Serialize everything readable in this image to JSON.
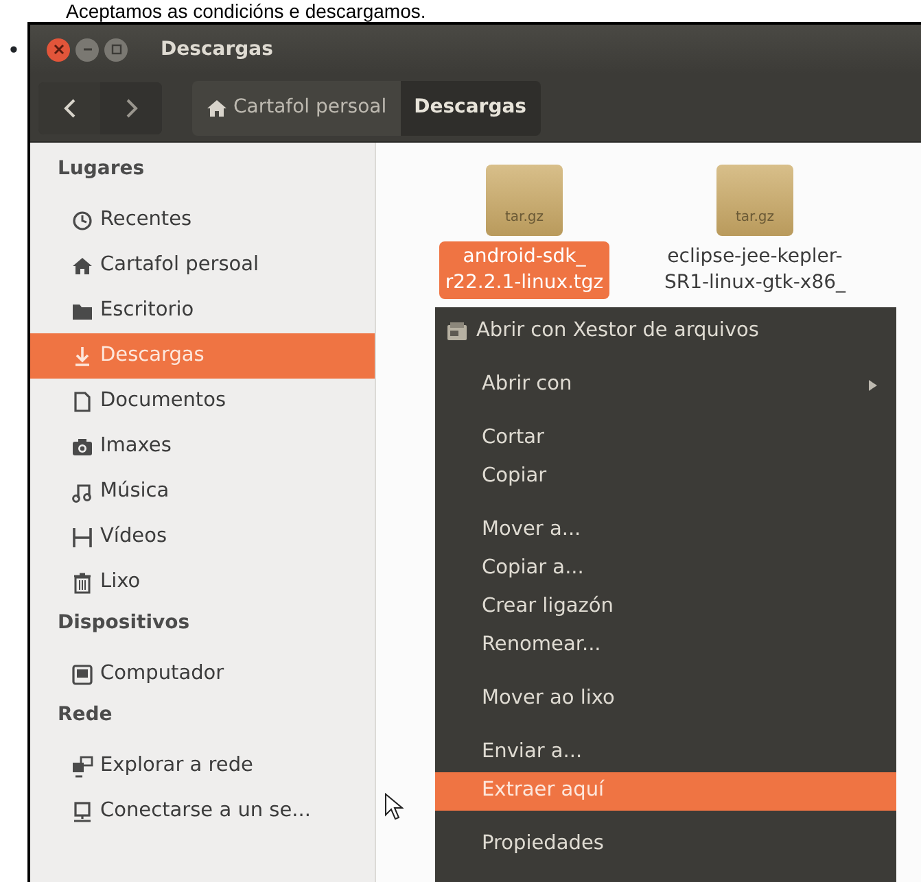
{
  "page_text": "Aceptamos as condicións e descargamos.",
  "bullet": "•",
  "window": {
    "title": "Descargas"
  },
  "breadcrumbs": [
    {
      "label": "Cartafol persoal",
      "kind": "home",
      "selected": false
    },
    {
      "label": "Descargas",
      "kind": "plain",
      "selected": true
    }
  ],
  "sidebar": {
    "sections": [
      {
        "title": "Lugares",
        "items": [
          {
            "label": "Recentes",
            "kind": "clock",
            "selected": false
          },
          {
            "label": "Cartafol persoal",
            "kind": "home",
            "selected": false
          },
          {
            "label": "Escritorio",
            "kind": "folder",
            "selected": false
          },
          {
            "label": "Descargas",
            "kind": "download",
            "selected": true
          },
          {
            "label": "Documentos",
            "kind": "document",
            "selected": false
          },
          {
            "label": "Imaxes",
            "kind": "camera",
            "selected": false
          },
          {
            "label": "Música",
            "kind": "music",
            "selected": false
          },
          {
            "label": "Vídeos",
            "kind": "film",
            "selected": false
          },
          {
            "label": "Lixo",
            "kind": "trash",
            "selected": false
          }
        ]
      },
      {
        "title": "Dispositivos",
        "items": [
          {
            "label": "Computador",
            "kind": "drive",
            "selected": false
          }
        ]
      },
      {
        "title": "Rede",
        "items": [
          {
            "label": "Explorar a rede",
            "kind": "network",
            "selected": false
          },
          {
            "label": "Conectarse a un se...",
            "kind": "server",
            "selected": false
          }
        ]
      }
    ]
  },
  "files": [
    {
      "badge": "tar.gz",
      "lines": [
        "android-sdk_",
        "r22.2.1-linux.tgz"
      ],
      "selected": true
    },
    {
      "badge": "tar.gz",
      "lines": [
        "eclipse-jee-kepler-",
        "SR1-linux-gtk-x86_"
      ],
      "selected": false
    }
  ],
  "context_menu": {
    "items": [
      {
        "label": "Abrir con Xestor de arquivos",
        "kind": "icon",
        "gap_before": false,
        "selected": false
      },
      {
        "label": "Abrir con",
        "kind": "submenu",
        "gap_before": true,
        "selected": false
      },
      {
        "label": "Cortar",
        "kind": "plain",
        "gap_before": true,
        "selected": false
      },
      {
        "label": "Copiar",
        "kind": "plain",
        "gap_before": false,
        "selected": false
      },
      {
        "label": "Mover a...",
        "kind": "plain",
        "gap_before": true,
        "selected": false
      },
      {
        "label": "Copiar a...",
        "kind": "plain",
        "gap_before": false,
        "selected": false
      },
      {
        "label": "Crear ligazón",
        "kind": "plain",
        "gap_before": false,
        "selected": false
      },
      {
        "label": "Renomear...",
        "kind": "plain",
        "gap_before": false,
        "selected": false
      },
      {
        "label": "Mover ao lixo",
        "kind": "plain",
        "gap_before": true,
        "selected": false
      },
      {
        "label": "Enviar a...",
        "kind": "plain",
        "gap_before": true,
        "selected": false
      },
      {
        "label": "Extraer aquí",
        "kind": "plain",
        "gap_before": false,
        "selected": true
      },
      {
        "label": "Propiedades",
        "kind": "plain",
        "gap_before": true,
        "selected": false
      }
    ]
  }
}
